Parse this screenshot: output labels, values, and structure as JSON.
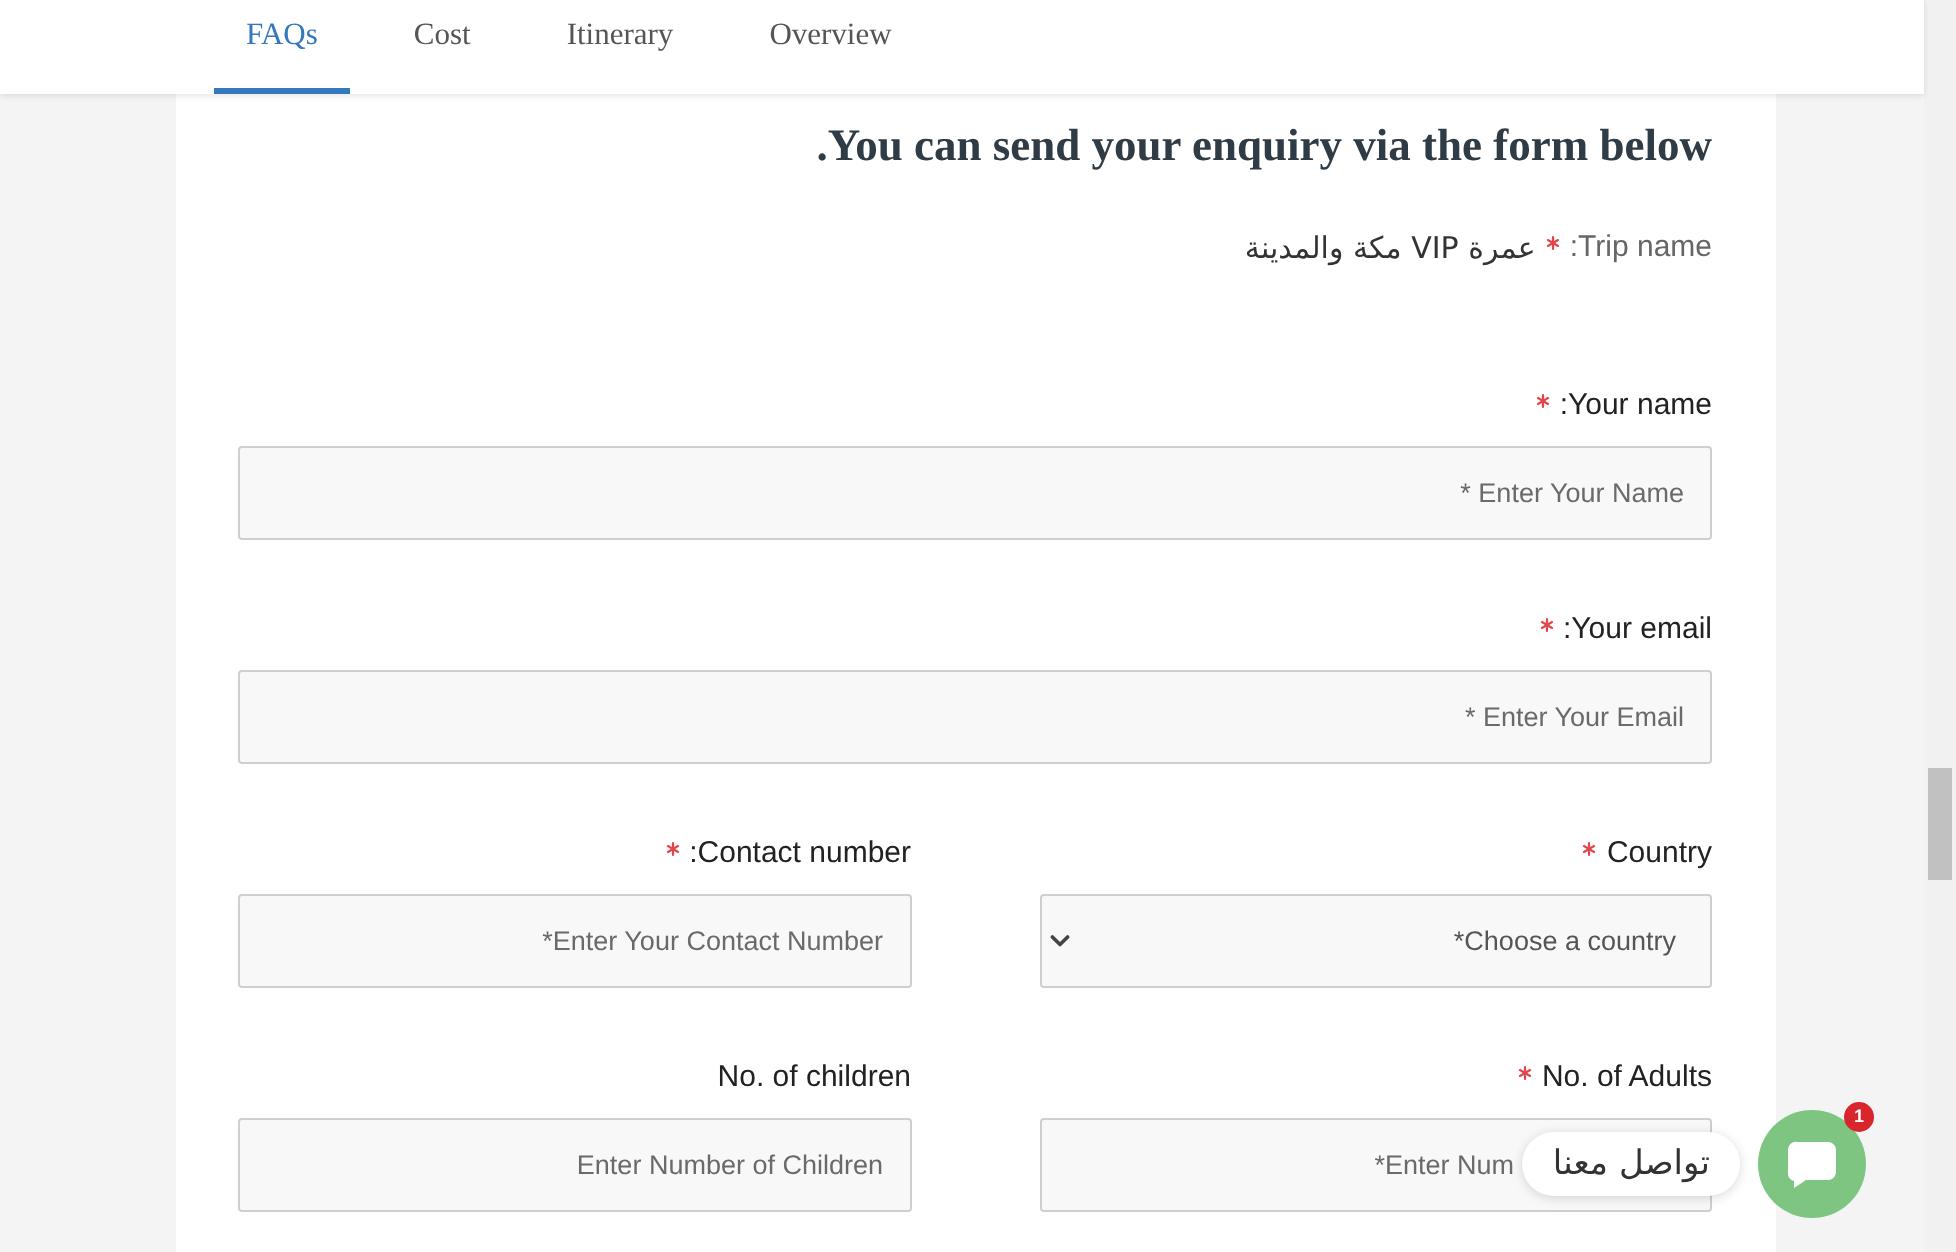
{
  "tabs": [
    {
      "label": "FAQs",
      "selected": true
    },
    {
      "label": "Cost",
      "selected": false
    },
    {
      "label": "Itinerary",
      "selected": false
    },
    {
      "label": "Overview",
      "selected": false
    }
  ],
  "form": {
    "heading": ".You can send your enquiry via the form below",
    "trip": {
      "label": ":Trip name",
      "required": true,
      "value": "عمرة VIP مكة والمدينة"
    },
    "rows": [
      [
        {
          "kind": "input",
          "label": ":Your name",
          "required": true,
          "placeholder": "* Enter Your Name"
        }
      ],
      [
        {
          "kind": "input",
          "label": ":Your email",
          "required": true,
          "placeholder": "* Enter Your Email"
        }
      ],
      [
        {
          "kind": "input",
          "label": ":Contact number",
          "required": true,
          "placeholder": "*Enter Your Contact Number"
        },
        {
          "kind": "select",
          "label": "Country",
          "required": true,
          "placeholder": "*Choose a country"
        }
      ],
      [
        {
          "kind": "input",
          "label": "No. of children",
          "required": false,
          "placeholder": "Enter Number of Children"
        },
        {
          "kind": "input",
          "label": "No. of Adults",
          "required": true,
          "placeholder": "*Enter Num"
        }
      ]
    ]
  },
  "chat": {
    "label": "تواصل معنا",
    "badge": "1"
  }
}
